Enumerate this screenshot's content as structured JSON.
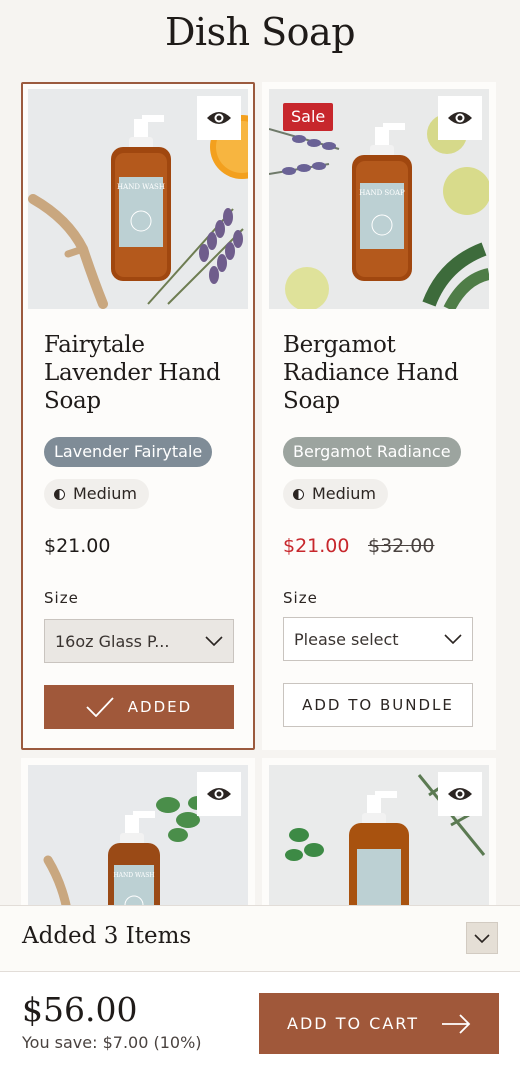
{
  "page": {
    "title": "Dish Soap"
  },
  "products": [
    {
      "title_lines": [
        "Fairytale",
        "Lavender Hand",
        "Soap"
      ],
      "scent_tag": "Lavender Fairytale",
      "scent_color": "#7f8c97",
      "strength": "Medium",
      "price": "$21.00",
      "size_label": "Size",
      "size_value": "16oz Glass P...",
      "button_label": "ADDED",
      "bottle_label": "HAND WASH",
      "selected": true
    },
    {
      "sale_badge": "Sale",
      "title_lines": [
        "Bergamot",
        "Radiance Hand",
        "Soap"
      ],
      "scent_tag": "Bergamot Radiance",
      "scent_color": "#9ca49f",
      "strength": "Medium",
      "price": "$21.00",
      "compare_price": "$32.00",
      "size_label": "Size",
      "size_value": "Please select",
      "button_label": "ADD TO BUNDLE",
      "bottle_label": "HAND SOAP"
    },
    {
      "bottle_label": "HAND WASH"
    },
    {
      "bottle_label": ""
    }
  ],
  "bundle_bar": {
    "added_text": "Added 3 Items",
    "total": "$56.00",
    "savings": "You save: $7.00 (10%)",
    "cta": "ADD TO CART"
  },
  "colors": {
    "accent": "#a0583a",
    "sale": "#c7272c",
    "background": "#f6f4f1"
  },
  "icons": [
    "eye-icon",
    "half-moon-icon",
    "chevron-down-icon",
    "checkmark-icon",
    "arrow-right-icon"
  ]
}
